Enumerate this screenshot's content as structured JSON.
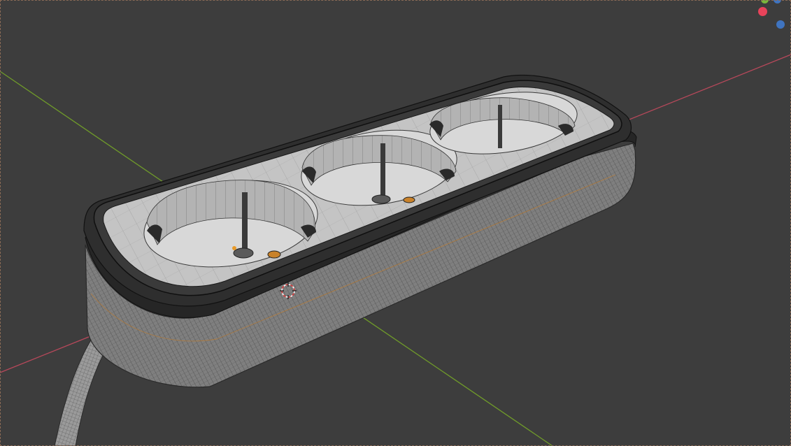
{
  "viewport": {
    "background": "#3d3d3d",
    "mode": "3d-wireframe-overlay",
    "object": "power-strip-3-socket",
    "colors": {
      "x_axis": "#b5485a",
      "y_axis": "#6f9a2a",
      "mesh_fill": "#8e8e8e",
      "mesh_dark": "#2a2a2a",
      "mesh_light": "#c9c9c9",
      "wire": "#3a3a3a",
      "accent": "#e58a1f"
    }
  },
  "gizmo": {
    "x_color": "#e8435a",
    "y_color": "#7ab63c",
    "z_color": "#3f74c0"
  },
  "cursor_3d": {
    "icon": "3d-cursor-icon"
  }
}
